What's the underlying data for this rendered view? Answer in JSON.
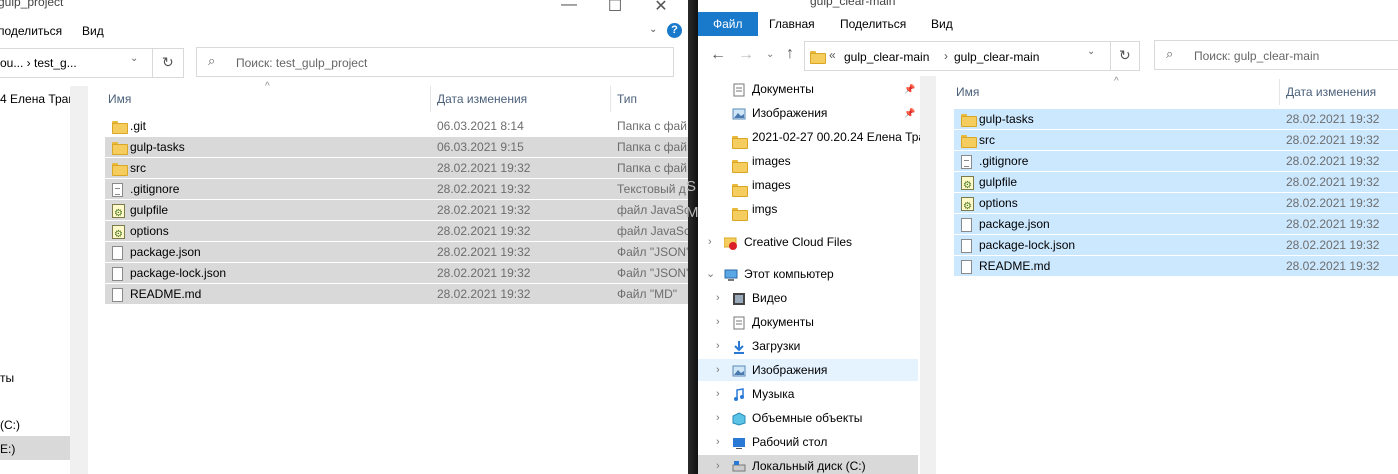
{
  "left": {
    "title": "gulp_project",
    "menu": {
      "share": "поделиться",
      "view": "Вид"
    },
    "breadcrumb": "ou... › test_g...",
    "search_placeholder": "Поиск: test_gulp_project",
    "nav_fragments": [
      "4 Елена Трап",
      "ты",
      "(C:)",
      "E:)"
    ],
    "columns": {
      "name": "Имя",
      "date": "Дата изменения",
      "type": "Тип"
    },
    "files": [
      {
        "name": ".git",
        "date": "06.03.2021 8:14",
        "type": "Папка с фай",
        "icon": "folder",
        "selected": false
      },
      {
        "name": "gulp-tasks",
        "date": "06.03.2021 9:15",
        "type": "Папка с фай",
        "icon": "folder",
        "selected": true
      },
      {
        "name": "src",
        "date": "28.02.2021 19:32",
        "type": "Папка с фай",
        "icon": "folder",
        "selected": true
      },
      {
        "name": ".gitignore",
        "date": "28.02.2021 19:32",
        "type": "Текстовый д",
        "icon": "text",
        "selected": true
      },
      {
        "name": "gulpfile",
        "date": "28.02.2021 19:32",
        "type": "файл JavaScr",
        "icon": "js",
        "selected": true
      },
      {
        "name": "options",
        "date": "28.02.2021 19:32",
        "type": "файл JavaScr",
        "icon": "js",
        "selected": true
      },
      {
        "name": "package.json",
        "date": "28.02.2021 19:32",
        "type": "Файл \"JSON\"",
        "icon": "file",
        "selected": true
      },
      {
        "name": "package-lock.json",
        "date": "28.02.2021 19:32",
        "type": "Файл \"JSON\"",
        "icon": "file",
        "selected": true
      },
      {
        "name": "README.md",
        "date": "28.02.2021 19:32",
        "type": "Файл \"MD\"",
        "icon": "file",
        "selected": true
      }
    ]
  },
  "separator_glyphs": [
    "S",
    "M"
  ],
  "right": {
    "title": "gulp_clear-main",
    "menu": {
      "file": "Файл",
      "home": "Главная",
      "share": "Поделиться",
      "view": "Вид"
    },
    "path": [
      "gulp_clear-main",
      "gulp_clear-main"
    ],
    "search_placeholder": "Поиск: gulp_clear-main",
    "quick_access": [
      {
        "label": "Документы",
        "icon": "documents",
        "pinned": true
      },
      {
        "label": "Изображения",
        "icon": "pictures",
        "pinned": true
      },
      {
        "label": "2021-02-27 00.20.24 Елена Трап",
        "icon": "folder",
        "pinned": false
      },
      {
        "label": "images",
        "icon": "folder",
        "pinned": false
      },
      {
        "label": "images",
        "icon": "folder",
        "pinned": false
      },
      {
        "label": "imgs",
        "icon": "folder",
        "pinned": false
      }
    ],
    "creative_cloud": "Creative Cloud Files",
    "this_pc": "Этот компьютер",
    "pc_items": [
      {
        "label": "Видео",
        "icon": "video",
        "selected": false
      },
      {
        "label": "Документы",
        "icon": "documents",
        "selected": false
      },
      {
        "label": "Загрузки",
        "icon": "downloads",
        "selected": false
      },
      {
        "label": "Изображения",
        "icon": "pictures",
        "selected": true
      },
      {
        "label": "Музыка",
        "icon": "music",
        "selected": false
      },
      {
        "label": "Объемные объекты",
        "icon": "3d-objects",
        "selected": false
      },
      {
        "label": "Рабочий стол",
        "icon": "desktop",
        "selected": false
      },
      {
        "label": "Локальный диск (C:)",
        "icon": "drive",
        "selected": false
      }
    ],
    "columns": {
      "name": "Имя",
      "date": "Дата изменения"
    },
    "files": [
      {
        "name": "gulp-tasks",
        "date": "28.02.2021 19:32",
        "icon": "folder"
      },
      {
        "name": "src",
        "date": "28.02.2021 19:32",
        "icon": "folder"
      },
      {
        "name": ".gitignore",
        "date": "28.02.2021 19:32",
        "icon": "text"
      },
      {
        "name": "gulpfile",
        "date": "28.02.2021 19:32",
        "icon": "js"
      },
      {
        "name": "options",
        "date": "28.02.2021 19:32",
        "icon": "js"
      },
      {
        "name": "package.json",
        "date": "28.02.2021 19:32",
        "icon": "file"
      },
      {
        "name": "package-lock.json",
        "date": "28.02.2021 19:32",
        "icon": "file"
      },
      {
        "name": "README.md",
        "date": "28.02.2021 19:32",
        "icon": "file"
      }
    ]
  },
  "colors": {
    "accent": "#1979ca",
    "selected_left": "#d9d9d9",
    "selected_right": "#cce8ff"
  }
}
